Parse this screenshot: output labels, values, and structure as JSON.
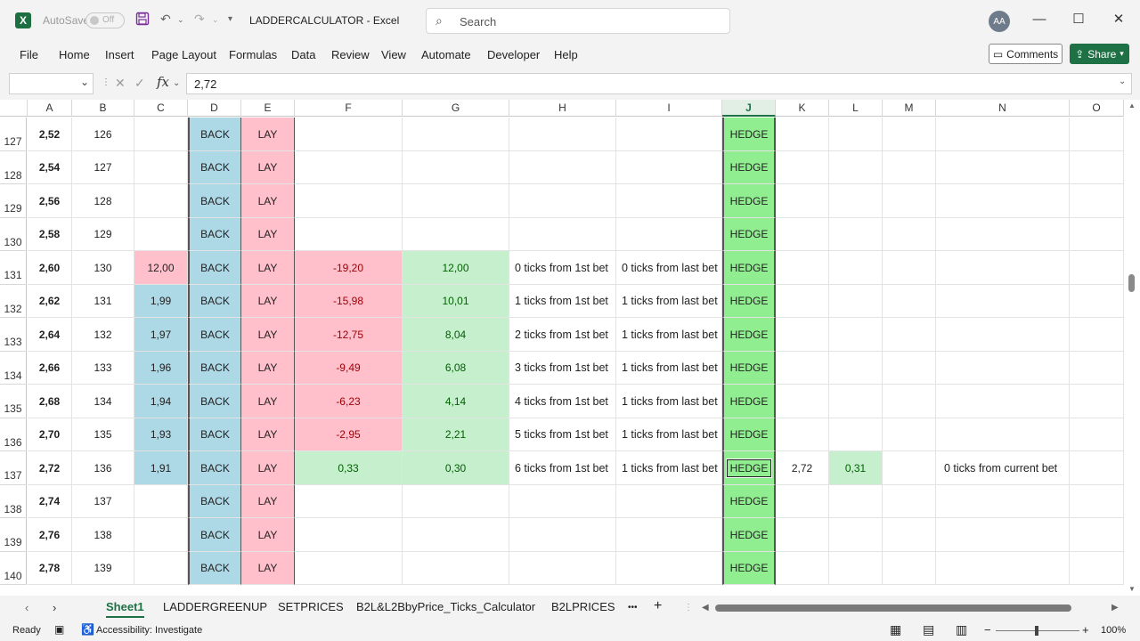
{
  "titlebar": {
    "app_icon": "X",
    "autosave_label": "AutoSave",
    "autosave_state": "Off",
    "doc_title": "LADDERCALCULATOR  -  Excel",
    "search_placeholder": "Search",
    "avatar_initials": "AA",
    "minimize": "—",
    "maximize": "☐",
    "close": "✕",
    "save_icon": "save-icon",
    "undo_icon": "undo-icon",
    "redo_icon": "redo-icon"
  },
  "ribbon": {
    "tabs": [
      "File",
      "Home",
      "Insert",
      "Page Layout",
      "Formulas",
      "Data",
      "Review",
      "View",
      "Automate",
      "Developer",
      "Help"
    ],
    "comments_label": "Comments",
    "share_label": "Share"
  },
  "formula_bar": {
    "name_box": "",
    "formula": "2,72"
  },
  "columns": [
    "A",
    "B",
    "C",
    "D",
    "E",
    "F",
    "G",
    "H",
    "I",
    "J",
    "K",
    "L",
    "M",
    "N",
    "O"
  ],
  "rows": [
    {
      "num": "127",
      "a": "2,52",
      "b": "126",
      "c": "",
      "d": "BACK",
      "e": "LAY",
      "f": "",
      "g": "",
      "h": "",
      "i": "",
      "j": "HEDGE",
      "k": "",
      "l": "",
      "n": ""
    },
    {
      "num": "128",
      "a": "2,54",
      "b": "127",
      "c": "",
      "d": "BACK",
      "e": "LAY",
      "f": "",
      "g": "",
      "h": "",
      "i": "",
      "j": "HEDGE",
      "k": "",
      "l": "",
      "n": ""
    },
    {
      "num": "129",
      "a": "2,56",
      "b": "128",
      "c": "",
      "d": "BACK",
      "e": "LAY",
      "f": "",
      "g": "",
      "h": "",
      "i": "",
      "j": "HEDGE",
      "k": "",
      "l": "",
      "n": ""
    },
    {
      "num": "130",
      "a": "2,58",
      "b": "129",
      "c": "",
      "d": "BACK",
      "e": "LAY",
      "f": "",
      "g": "",
      "h": "",
      "i": "",
      "j": "HEDGE",
      "k": "",
      "l": "",
      "n": ""
    },
    {
      "num": "131",
      "a": "2,60",
      "b": "130",
      "c": "12,00",
      "d": "BACK",
      "e": "LAY",
      "f": "-19,20",
      "g": "12,00",
      "h": "0 ticks from 1st bet",
      "i": "0 ticks from last bet",
      "j": "HEDGE",
      "k": "",
      "l": "",
      "n": ""
    },
    {
      "num": "132",
      "a": "2,62",
      "b": "131",
      "c": "1,99",
      "d": "BACK",
      "e": "LAY",
      "f": "-15,98",
      "g": "10,01",
      "h": "1 ticks from 1st bet",
      "i": "1 ticks from last bet",
      "j": "HEDGE",
      "k": "",
      "l": "",
      "n": ""
    },
    {
      "num": "133",
      "a": "2,64",
      "b": "132",
      "c": "1,97",
      "d": "BACK",
      "e": "LAY",
      "f": "-12,75",
      "g": "8,04",
      "h": "2 ticks from 1st bet",
      "i": "1 ticks from last bet",
      "j": "HEDGE",
      "k": "",
      "l": "",
      "n": ""
    },
    {
      "num": "134",
      "a": "2,66",
      "b": "133",
      "c": "1,96",
      "d": "BACK",
      "e": "LAY",
      "f": "-9,49",
      "g": "6,08",
      "h": "3 ticks from 1st bet",
      "i": "1 ticks from last bet",
      "j": "HEDGE",
      "k": "",
      "l": "",
      "n": ""
    },
    {
      "num": "135",
      "a": "2,68",
      "b": "134",
      "c": "1,94",
      "d": "BACK",
      "e": "LAY",
      "f": "-6,23",
      "g": "4,14",
      "h": "4 ticks from 1st bet",
      "i": "1 ticks from last bet",
      "j": "HEDGE",
      "k": "",
      "l": "",
      "n": ""
    },
    {
      "num": "136",
      "a": "2,70",
      "b": "135",
      "c": "1,93",
      "d": "BACK",
      "e": "LAY",
      "f": "-2,95",
      "g": "2,21",
      "h": "5 ticks from 1st bet",
      "i": "1 ticks from last bet",
      "j": "HEDGE",
      "k": "",
      "l": "",
      "n": ""
    },
    {
      "num": "137",
      "a": "2,72",
      "b": "136",
      "c": "1,91",
      "d": "BACK",
      "e": "LAY",
      "f": "0,33",
      "g": "0,30",
      "h": "6 ticks from 1st bet",
      "i": "1 ticks from last bet",
      "j": "HEDGE",
      "k": "2,72",
      "l": "0,31",
      "n": "0 ticks from current bet"
    },
    {
      "num": "138",
      "a": "2,74",
      "b": "137",
      "c": "",
      "d": "BACK",
      "e": "LAY",
      "f": "",
      "g": "",
      "h": "",
      "i": "",
      "j": "HEDGE",
      "k": "",
      "l": "",
      "n": ""
    },
    {
      "num": "139",
      "a": "2,76",
      "b": "138",
      "c": "",
      "d": "BACK",
      "e": "LAY",
      "f": "",
      "g": "",
      "h": "",
      "i": "",
      "j": "HEDGE",
      "k": "",
      "l": "",
      "n": ""
    },
    {
      "num": "140",
      "a": "2,78",
      "b": "139",
      "c": "",
      "d": "BACK",
      "e": "LAY",
      "f": "",
      "g": "",
      "h": "",
      "i": "",
      "j": "HEDGE",
      "k": "",
      "l": "",
      "n": ""
    }
  ],
  "sheet_tabs": [
    "Sheet1",
    "LADDERGREENUP",
    "SETPRICES",
    "B2L&L2BbyPrice_Ticks_Calculator",
    "B2LPRICES"
  ],
  "active_sheet": "Sheet1",
  "tabs_more": "•••",
  "add_sheet": "+",
  "status": {
    "ready": "Ready",
    "accessibility": "Accessibility: Investigate",
    "zoom": "100%",
    "zoom_minus": "−",
    "zoom_plus": "+"
  },
  "colors": {
    "back": "#add8e6",
    "lay": "#ffc0cb",
    "hedge": "#90ee90",
    "profit": "#c6efce",
    "accent": "#1e7145"
  }
}
